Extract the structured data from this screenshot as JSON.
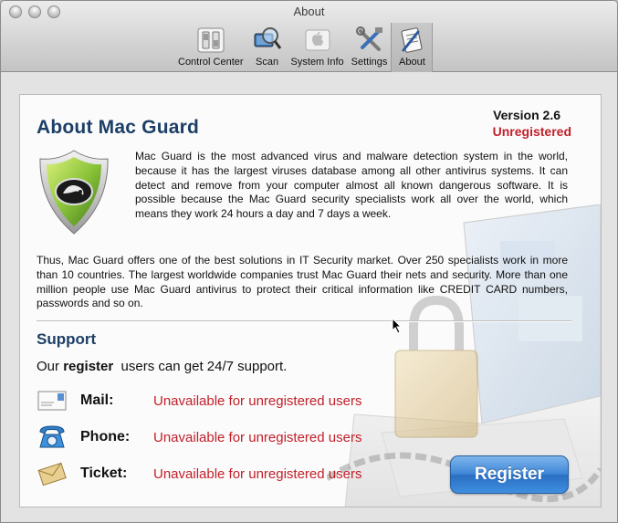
{
  "window": {
    "title": "About"
  },
  "toolbar": {
    "items": [
      {
        "label": "Control Center",
        "icon": "control-center-icon"
      },
      {
        "label": "Scan",
        "icon": "scan-magnifier-icon"
      },
      {
        "label": "System Info",
        "icon": "system-info-apple-icon"
      },
      {
        "label": "Settings",
        "icon": "settings-tools-icon"
      },
      {
        "label": "About",
        "icon": "about-icon",
        "active": true
      }
    ]
  },
  "about": {
    "title": "About Mac Guard",
    "version": "Version 2.6",
    "status": "Unregistered",
    "paragraph1": "Mac Guard is the most advanced virus and malware detection system in the world,  because it has the largest viruses database among all other antivirus systems. It can detect and remove from your computer almost all known dangerous software. It is possible because the Mac Guard security specialists work all over the world, which means they work 24 hours a day and  7 days a week.",
    "paragraph2": "Thus, Mac Guard offers one of the best solutions in IT Security market. Over 250 specialists work in more than 10 countries. The largest worldwide companies trust Mac Guard their nets and security. More than one million people use Mac Guard antivirus to protect their critical information like CREDIT CARD numbers, passwords and so on."
  },
  "support": {
    "title": "Support",
    "line_prefix": "Our ",
    "line_bold": "register",
    "line_suffix": "  users can get 24/7 support.",
    "rows": [
      {
        "label": "Mail:",
        "status": "Unavailable for unregistered users",
        "icon": "mail-icon"
      },
      {
        "label": "Phone:",
        "status": "Unavailable for unregistered users",
        "icon": "phone-icon"
      },
      {
        "label": "Ticket:",
        "status": "Unavailable for unregistered users",
        "icon": "ticket-envelope-icon"
      }
    ]
  },
  "register_button": {
    "label": "Register"
  },
  "colors": {
    "heading": "#1d3f66",
    "alert": "#c2202a",
    "button": "#3e86d6"
  }
}
